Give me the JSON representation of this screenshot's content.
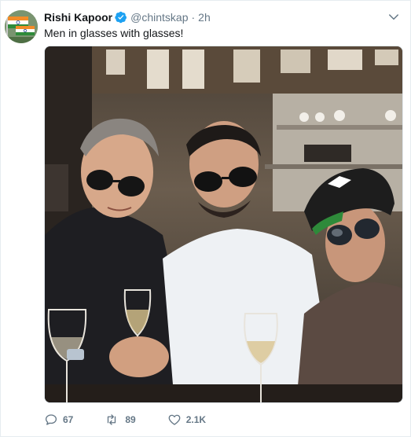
{
  "author": {
    "name": "Rishi Kapoor",
    "handle": "@chintskap",
    "time": "2h",
    "verified": true,
    "avatar_icon": "indian-flag-avatar"
  },
  "tweet": {
    "text": "Men in glasses with glasses!",
    "image_alt": "Three men wearing sunglasses sitting at a restaurant table with wine glasses"
  },
  "actions": {
    "replies": "67",
    "retweets": "89",
    "likes": "2.1K"
  },
  "colors": {
    "icon_gray": "#657786",
    "verified_blue": "#1da1f2"
  }
}
